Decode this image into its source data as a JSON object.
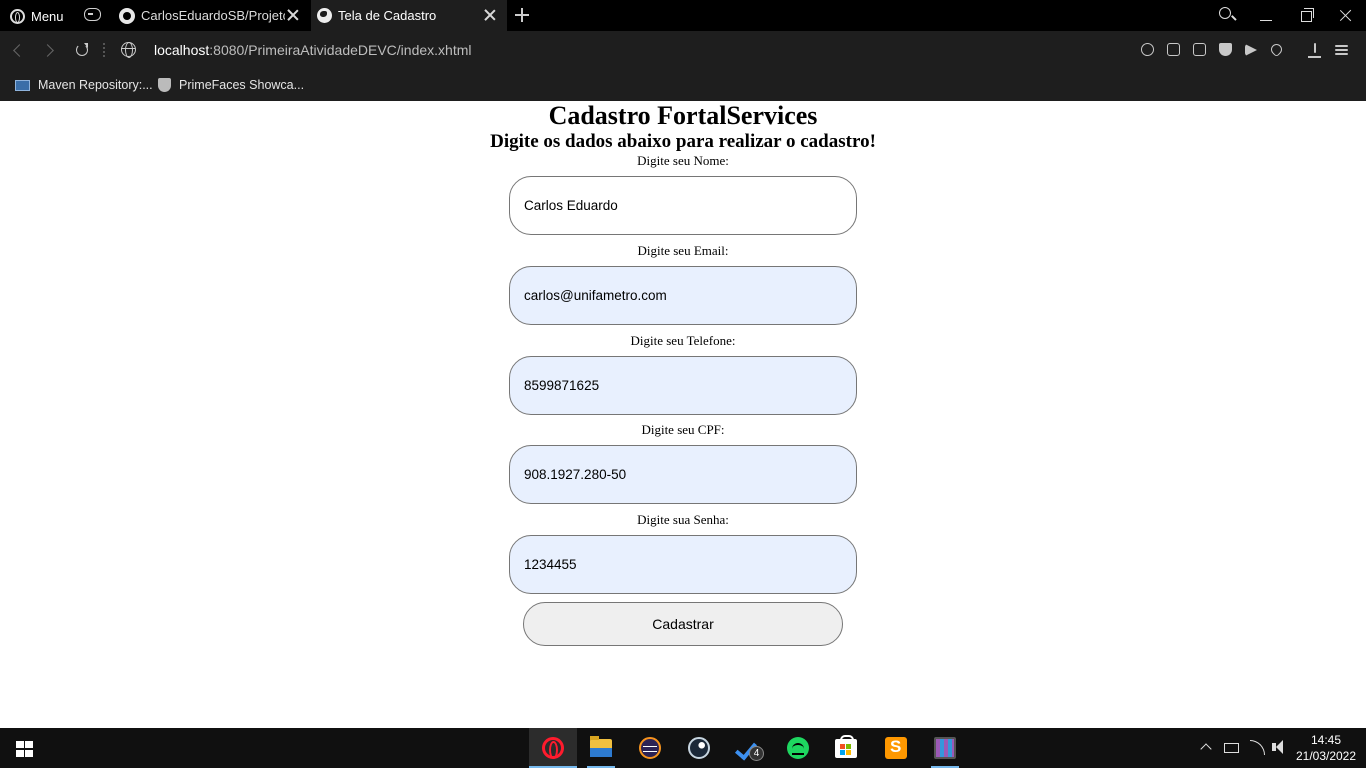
{
  "browser": {
    "menu_label": "Menu",
    "tabs": [
      {
        "title": "CarlosEduardoSB/ProjetoWeb",
        "icon": "github-icon",
        "active": false
      },
      {
        "title": "Tela de Cadastro",
        "icon": "globe-icon",
        "active": true
      }
    ],
    "address": {
      "host": "localhost",
      "path": ":8080/PrimeiraAtividadeDEVC/index.xhtml"
    },
    "bookmarks": [
      {
        "label": "Maven Repository:...",
        "icon": "maven-icon"
      },
      {
        "label": "PrimeFaces Showca...",
        "icon": "primefaces-icon"
      }
    ]
  },
  "page": {
    "title": "Cadastro FortalServices",
    "subtitle": "Digite os dados abaixo para realizar o cadastro!",
    "fields": [
      {
        "label": "Digite seu Nome:",
        "value": "Carlos Eduardo"
      },
      {
        "label": "Digite seu Email:",
        "value": "carlos@unifametro.com"
      },
      {
        "label": "Digite seu Telefone:",
        "value": "8599871625"
      },
      {
        "label": "Digite seu CPF:",
        "value": "908.1927.280-50"
      },
      {
        "label": "Digite sua Senha:",
        "value": "1234455"
      }
    ],
    "submit_label": "Cadastrar"
  },
  "taskbar": {
    "apps": [
      "opera-icon",
      "file-explorer-icon",
      "eclipse-icon",
      "steam-icon",
      "todo-icon",
      "spotify-icon",
      "store-icon",
      "sublime-text-icon",
      "ide-icon"
    ],
    "todo_badge": "4",
    "time": "14:45",
    "date": "21/03/2022"
  }
}
